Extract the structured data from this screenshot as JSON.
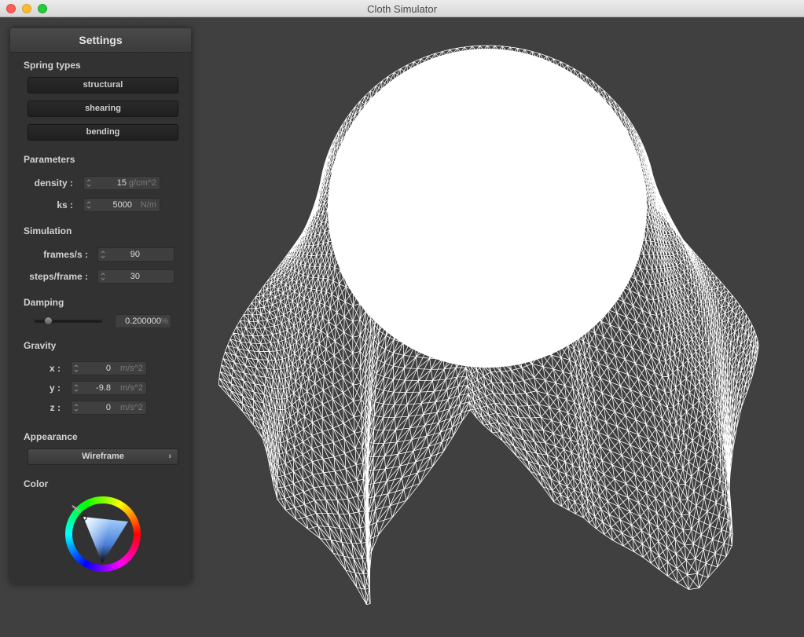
{
  "window": {
    "title": "Cloth Simulator"
  },
  "panel": {
    "title": "Settings",
    "spring_types": {
      "label": "Spring types",
      "buttons": [
        "structural",
        "shearing",
        "bending"
      ]
    },
    "parameters": {
      "label": "Parameters",
      "density": {
        "label": "density :",
        "value": "15",
        "unit": "g/cm^2"
      },
      "ks": {
        "label": "ks :",
        "value": "5000",
        "unit": "N/m"
      }
    },
    "simulation": {
      "label": "Simulation",
      "fps": {
        "label": "frames/s :",
        "value": "90"
      },
      "steps": {
        "label": "steps/frame :",
        "value": "30"
      }
    },
    "damping": {
      "label": "Damping",
      "value": "0.200000",
      "unit": "%",
      "slider_fraction": 0.2
    },
    "gravity": {
      "label": "Gravity",
      "x": {
        "label": "x :",
        "value": "0",
        "unit": "m/s^2"
      },
      "y": {
        "label": "y :",
        "value": "-9.8",
        "unit": "m/s^2"
      },
      "z": {
        "label": "z :",
        "value": "0",
        "unit": "m/s^2"
      }
    },
    "appearance": {
      "label": "Appearance",
      "selected": "Wireframe",
      "chevron": "›"
    },
    "color": {
      "label": "Color",
      "selected_color": "#ffffff"
    }
  },
  "scene": {
    "background": "#404040",
    "mesh_color": "#ffffff",
    "sphere_color": "#ffffff"
  },
  "icons": [
    "close-icon",
    "minimize-icon",
    "maximize-icon",
    "spinner-icon",
    "chevron-right-icon",
    "color-wheel-icon"
  ]
}
